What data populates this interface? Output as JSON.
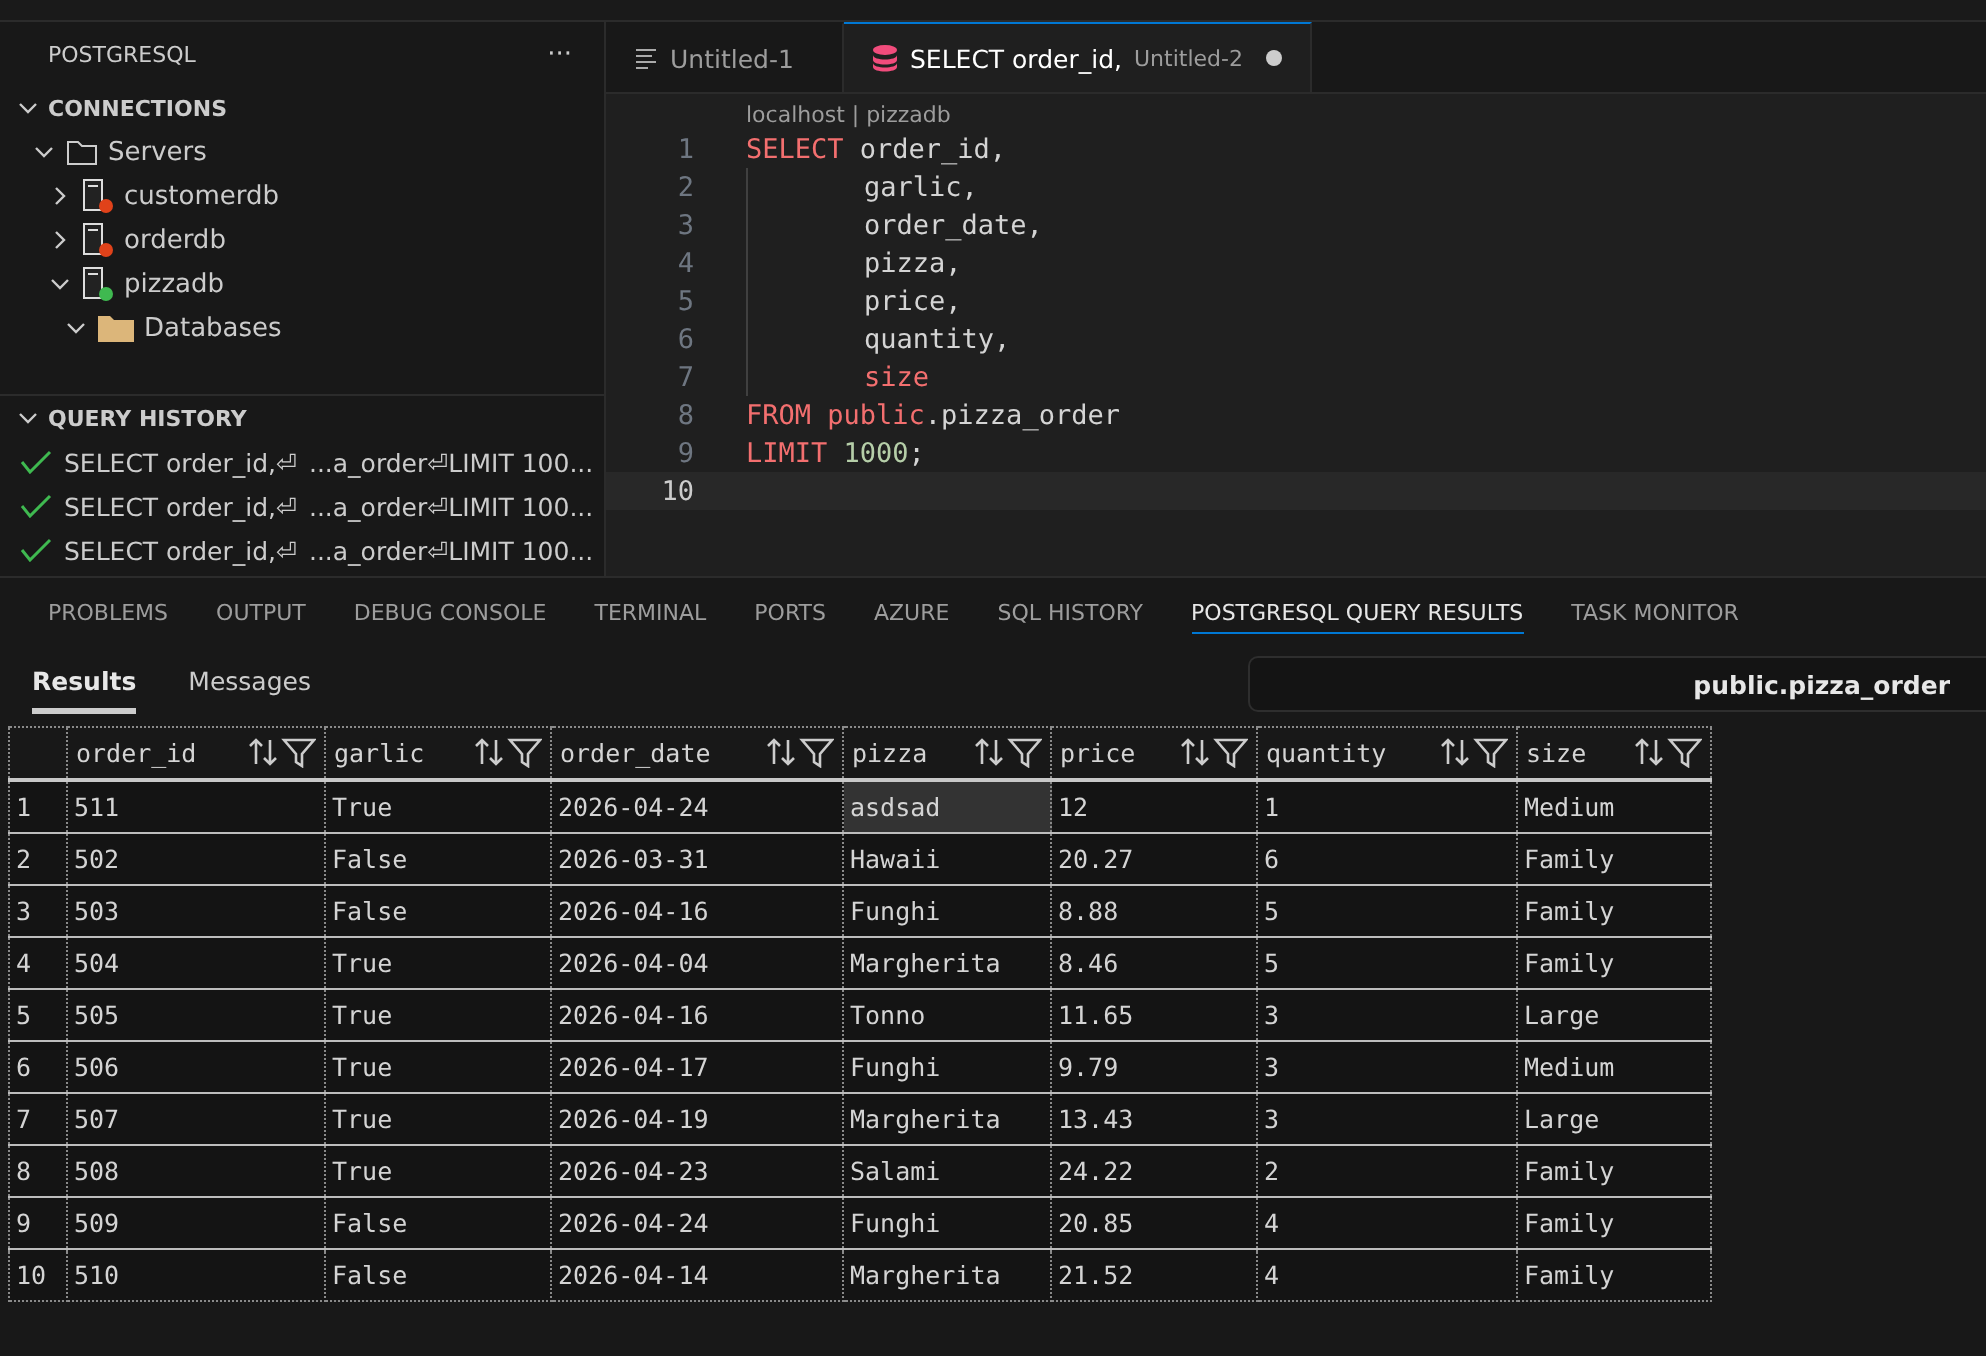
{
  "sidebar": {
    "title": "POSTGRESQL",
    "more": "···",
    "connections": {
      "title": "CONNECTIONS",
      "expanded": true,
      "tree": [
        {
          "label": "Servers",
          "kind": "folder",
          "expanded": true,
          "children": [
            {
              "label": "customerdb",
              "kind": "server",
              "expanded": false,
              "color": "#e0421a"
            },
            {
              "label": "orderdb",
              "kind": "server",
              "expanded": false,
              "color": "#e0421a"
            },
            {
              "label": "pizzadb",
              "kind": "server",
              "expanded": true,
              "color": "#3fb950",
              "children": [
                {
                  "label": "Databases",
                  "kind": "dbfolder",
                  "expanded": true
                }
              ]
            }
          ]
        }
      ]
    },
    "history": {
      "title": "QUERY HISTORY",
      "expanded": true,
      "items": [
        {
          "start": "SELECT order_id,⏎",
          "end": "...a_order⏎LIMIT 100..."
        },
        {
          "start": "SELECT order_id,⏎",
          "end": "...a_order⏎LIMIT 100..."
        },
        {
          "start": "SELECT order_id,⏎",
          "end": "...a_order⏎LIMIT 100..."
        }
      ]
    }
  },
  "editor": {
    "tabs": [
      {
        "label": "Untitled-1",
        "kind": "text",
        "selected": false
      },
      {
        "label": "SELECT order_id,",
        "detail": "Untitled-2",
        "kind": "sql",
        "selected": true,
        "dirty": true
      }
    ],
    "breadcrumb": "localhost | pizzadb",
    "lines": [
      {
        "number": "1",
        "indent": false,
        "current": false,
        "tokens": [
          {
            "kind": "keyword",
            "text": "SELECT"
          },
          {
            "kind": "plain",
            "text": " order_id,"
          }
        ]
      },
      {
        "number": "2",
        "indent": true,
        "current": false,
        "tokens": [
          {
            "kind": "plain",
            "text": "garlic,"
          }
        ]
      },
      {
        "number": "3",
        "indent": true,
        "current": false,
        "tokens": [
          {
            "kind": "plain",
            "text": "order_date,"
          }
        ]
      },
      {
        "number": "4",
        "indent": true,
        "current": false,
        "tokens": [
          {
            "kind": "plain",
            "text": "pizza,"
          }
        ]
      },
      {
        "number": "5",
        "indent": true,
        "current": false,
        "tokens": [
          {
            "kind": "plain",
            "text": "price,"
          }
        ]
      },
      {
        "number": "6",
        "indent": true,
        "current": false,
        "tokens": [
          {
            "kind": "plain",
            "text": "quantity,"
          }
        ]
      },
      {
        "number": "7",
        "indent": true,
        "current": false,
        "tokens": [
          {
            "kind": "keyword",
            "text": "size"
          }
        ]
      },
      {
        "number": "8",
        "indent": false,
        "current": false,
        "tokens": [
          {
            "kind": "keyword",
            "text": "FROM"
          },
          {
            "kind": "keyword",
            "text": " public"
          },
          {
            "kind": "plain",
            "text": ".pizza_order"
          }
        ]
      },
      {
        "number": "9",
        "indent": false,
        "current": false,
        "tokens": [
          {
            "kind": "keyword",
            "text": "LIMIT"
          },
          {
            "kind": "number",
            "text": " 1000"
          },
          {
            "kind": "plain",
            "text": ";"
          }
        ]
      },
      {
        "number": "10",
        "indent": false,
        "current": true
      }
    ]
  },
  "panel": {
    "tabs": [
      {
        "label": "PROBLEMS",
        "selected": false
      },
      {
        "label": "OUTPUT",
        "selected": false
      },
      {
        "label": "DEBUG CONSOLE",
        "selected": false
      },
      {
        "label": "TERMINAL",
        "selected": false
      },
      {
        "label": "PORTS",
        "selected": false
      },
      {
        "label": "AZURE",
        "selected": false
      },
      {
        "label": "SQL HISTORY",
        "selected": false
      },
      {
        "label": "POSTGRESQL QUERY RESULTS",
        "selected": true
      },
      {
        "label": "TASK MONITOR",
        "selected": false
      }
    ],
    "result_tabs": [
      {
        "label": "Results",
        "selected": true
      },
      {
        "label": "Messages",
        "selected": false
      }
    ],
    "table_name": "public.pizza_order",
    "table": {
      "columns": [
        "order_id",
        "garlic",
        "order_date",
        "pizza",
        "price",
        "quantity",
        "size"
      ],
      "rows": [
        {
          "number": "1",
          "cells": [
            {
              "text": "511",
              "selected": false
            },
            {
              "text": "True",
              "selected": false
            },
            {
              "text": "2026-04-24",
              "selected": false
            },
            {
              "text": "asdsad",
              "selected": true
            },
            {
              "text": "12",
              "selected": false
            },
            {
              "text": "1",
              "selected": false
            },
            {
              "text": "Medium",
              "selected": false
            }
          ]
        },
        {
          "number": "2",
          "cells": [
            {
              "text": "502",
              "selected": false
            },
            {
              "text": "False",
              "selected": false
            },
            {
              "text": "2026-03-31",
              "selected": false
            },
            {
              "text": "Hawaii",
              "selected": false
            },
            {
              "text": "20.27",
              "selected": false
            },
            {
              "text": "6",
              "selected": false
            },
            {
              "text": "Family",
              "selected": false
            }
          ]
        },
        {
          "number": "3",
          "cells": [
            {
              "text": "503",
              "selected": false
            },
            {
              "text": "False",
              "selected": false
            },
            {
              "text": "2026-04-16",
              "selected": false
            },
            {
              "text": "Funghi",
              "selected": false
            },
            {
              "text": "8.88",
              "selected": false
            },
            {
              "text": "5",
              "selected": false
            },
            {
              "text": "Family",
              "selected": false
            }
          ]
        },
        {
          "number": "4",
          "cells": [
            {
              "text": "504",
              "selected": false
            },
            {
              "text": "True",
              "selected": false
            },
            {
              "text": "2026-04-04",
              "selected": false
            },
            {
              "text": "Margherita",
              "selected": false
            },
            {
              "text": "8.46",
              "selected": false
            },
            {
              "text": "5",
              "selected": false
            },
            {
              "text": "Family",
              "selected": false
            }
          ]
        },
        {
          "number": "5",
          "cells": [
            {
              "text": "505",
              "selected": false
            },
            {
              "text": "True",
              "selected": false
            },
            {
              "text": "2026-04-16",
              "selected": false
            },
            {
              "text": "Tonno",
              "selected": false
            },
            {
              "text": "11.65",
              "selected": false
            },
            {
              "text": "3",
              "selected": false
            },
            {
              "text": "Large",
              "selected": false
            }
          ]
        },
        {
          "number": "6",
          "cells": [
            {
              "text": "506",
              "selected": false
            },
            {
              "text": "True",
              "selected": false
            },
            {
              "text": "2026-04-17",
              "selected": false
            },
            {
              "text": "Funghi",
              "selected": false
            },
            {
              "text": "9.79",
              "selected": false
            },
            {
              "text": "3",
              "selected": false
            },
            {
              "text": "Medium",
              "selected": false
            }
          ]
        },
        {
          "number": "7",
          "cells": [
            {
              "text": "507",
              "selected": false
            },
            {
              "text": "True",
              "selected": false
            },
            {
              "text": "2026-04-19",
              "selected": false
            },
            {
              "text": "Margherita",
              "selected": false
            },
            {
              "text": "13.43",
              "selected": false
            },
            {
              "text": "3",
              "selected": false
            },
            {
              "text": "Large",
              "selected": false
            }
          ]
        },
        {
          "number": "8",
          "cells": [
            {
              "text": "508",
              "selected": false
            },
            {
              "text": "True",
              "selected": false
            },
            {
              "text": "2026-04-23",
              "selected": false
            },
            {
              "text": "Salami",
              "selected": false
            },
            {
              "text": "24.22",
              "selected": false
            },
            {
              "text": "2",
              "selected": false
            },
            {
              "text": "Family",
              "selected": false
            }
          ]
        },
        {
          "number": "9",
          "cells": [
            {
              "text": "509",
              "selected": false
            },
            {
              "text": "False",
              "selected": false
            },
            {
              "text": "2026-04-24",
              "selected": false
            },
            {
              "text": "Funghi",
              "selected": false
            },
            {
              "text": "20.85",
              "selected": false
            },
            {
              "text": "4",
              "selected": false
            },
            {
              "text": "Family",
              "selected": false
            }
          ]
        },
        {
          "number": "10",
          "cells": [
            {
              "text": "510",
              "selected": false
            },
            {
              "text": "False",
              "selected": false
            },
            {
              "text": "2026-04-14",
              "selected": false
            },
            {
              "text": "Margherita",
              "selected": false
            },
            {
              "text": "21.52",
              "selected": false
            },
            {
              "text": "4",
              "selected": false
            },
            {
              "text": "Family",
              "selected": false
            }
          ]
        }
      ]
    }
  }
}
